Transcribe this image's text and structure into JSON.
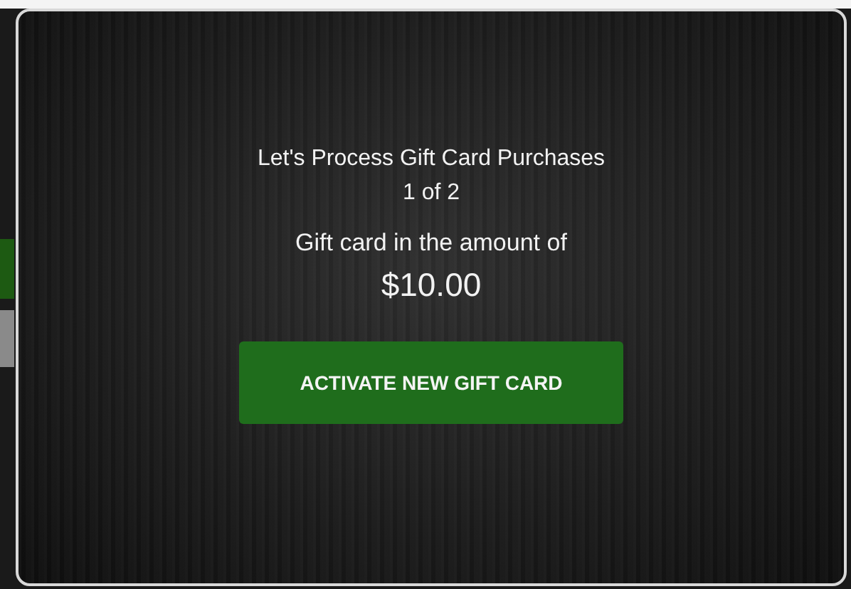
{
  "dialog": {
    "title": "Let's Process Gift Card Purchases",
    "counter": "1 of 2",
    "label": "Gift card in the amount of",
    "amount": "$10.00",
    "button": "ACTIVATE NEW GIFT CARD"
  }
}
